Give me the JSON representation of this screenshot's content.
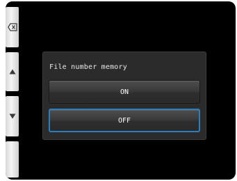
{
  "sidebar": {
    "buttons": [
      {
        "icon": "backspace-icon"
      },
      {
        "icon": "up-arrow-icon"
      },
      {
        "icon": "down-arrow-icon"
      },
      {
        "icon": ""
      }
    ]
  },
  "dialog": {
    "title": "File number memory",
    "options": [
      {
        "label": "ON",
        "selected": false
      },
      {
        "label": "OFF",
        "selected": true
      }
    ]
  },
  "colors": {
    "background": "#000000",
    "dialog_bg": "#2b2b2b",
    "selected_border": "#2b7fc0",
    "side_button": "#e6e6e6"
  }
}
